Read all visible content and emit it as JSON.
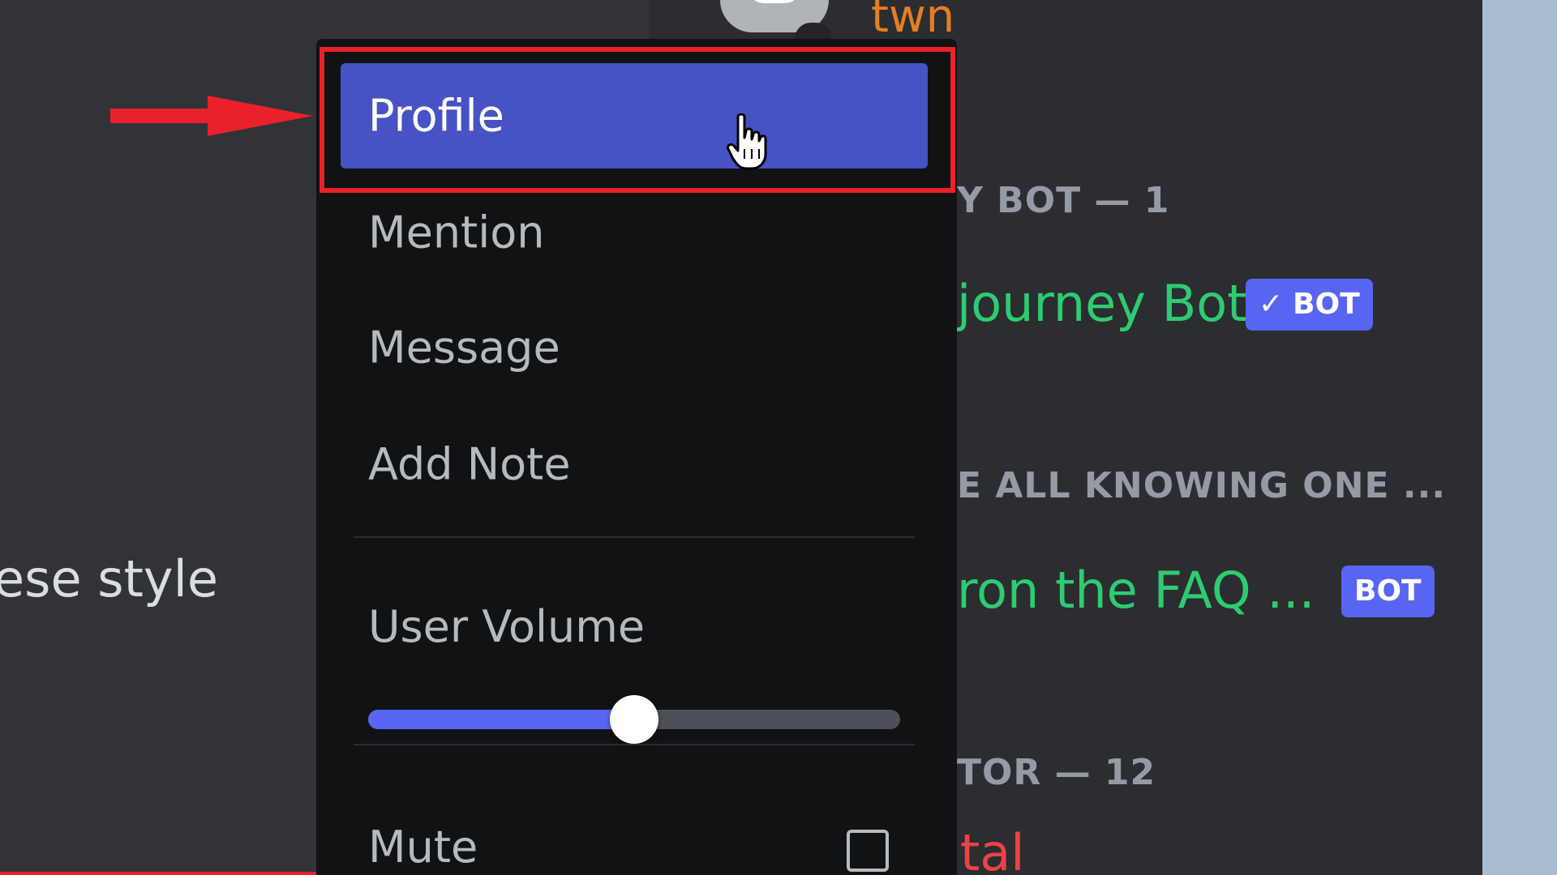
{
  "chat": {
    "visible_text": "ese style"
  },
  "member_list": {
    "top_member_name": "twn",
    "groups": [
      {
        "header": "Y BOT — 1",
        "member": "journey Bot",
        "tag": "BOT",
        "tag_verified": true
      },
      {
        "header": "E ALL KNOWING ONE ...",
        "member": "ron the FAQ ...",
        "tag": "BOT",
        "tag_verified": false
      },
      {
        "header": "TOR — 12",
        "member": "tal"
      }
    ]
  },
  "context_menu": {
    "items": [
      {
        "label": "Profile",
        "active": true
      },
      {
        "label": "Mention"
      },
      {
        "label": "Message"
      },
      {
        "label": "Add Note"
      }
    ],
    "user_volume": {
      "label": "User Volume",
      "value_percent": 50
    },
    "mute": {
      "label": "Mute",
      "checked": false
    }
  },
  "colors": {
    "accent": "#5865f2",
    "active_item": "#4752c4",
    "annotation_red": "#e8212b",
    "member_green": "#2ecc71",
    "member_orange": "#e67e22",
    "member_red": "#ed4245"
  },
  "icons": [
    "arrow-annotation-icon",
    "hand-pointer-cursor-icon",
    "checkmark-icon",
    "default-avatar-icon"
  ]
}
